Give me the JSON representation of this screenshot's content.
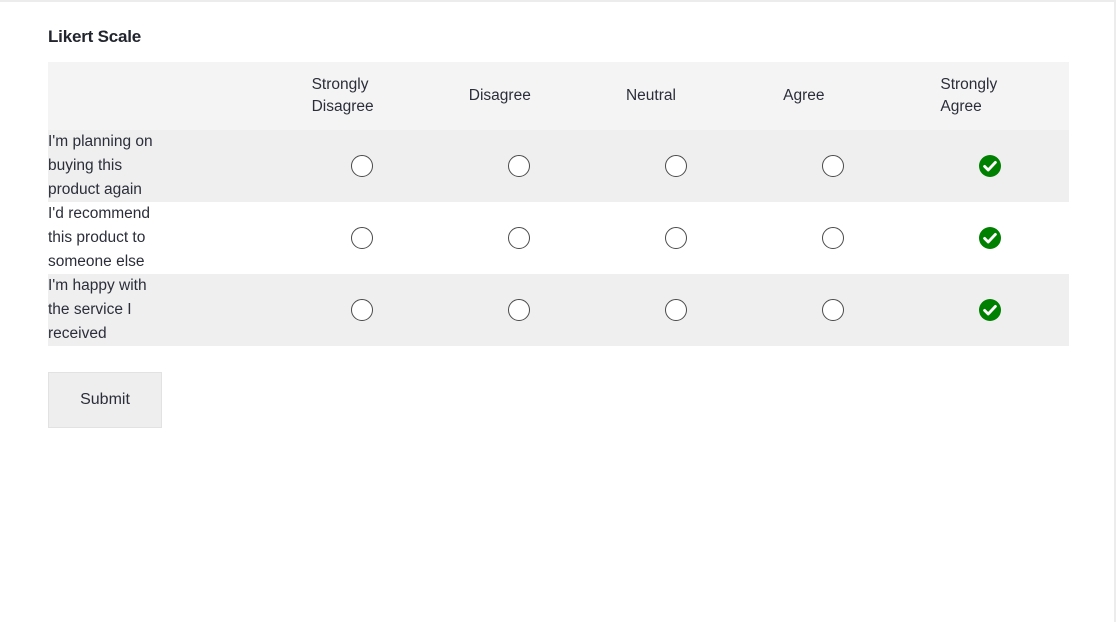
{
  "page": {
    "title": "Likert Scale"
  },
  "table": {
    "corner_header": "",
    "columns": [
      {
        "label": "Strongly Disagree",
        "value": "strongly-disagree"
      },
      {
        "label": "Disagree",
        "value": "disagree"
      },
      {
        "label": "Neutral",
        "value": "neutral"
      },
      {
        "label": "Agree",
        "value": "agree"
      },
      {
        "label": "Strongly Agree",
        "value": "strongly-agree"
      }
    ],
    "rows": [
      {
        "question": "I'm planning on buying this product again",
        "selected_index": 4,
        "striped": true
      },
      {
        "question": "I'd recommend this product to someone else",
        "selected_index": 4,
        "striped": false
      },
      {
        "question": "I'm happy with the service I received",
        "selected_index": 4,
        "striped": true
      }
    ]
  },
  "actions": {
    "submit_label": "Submit"
  },
  "icons": {
    "checked": "check-circle-filled-icon",
    "unchecked": "radio-unchecked-icon"
  },
  "colors": {
    "checked_green": "#008000",
    "header_bg": "#f4f4f4",
    "stripe_bg": "#efefef",
    "row_bg": "#ffffff",
    "text": "#2b2e3a",
    "submit_bg": "#eeeeee",
    "radio_border": "#4a4a4a"
  }
}
